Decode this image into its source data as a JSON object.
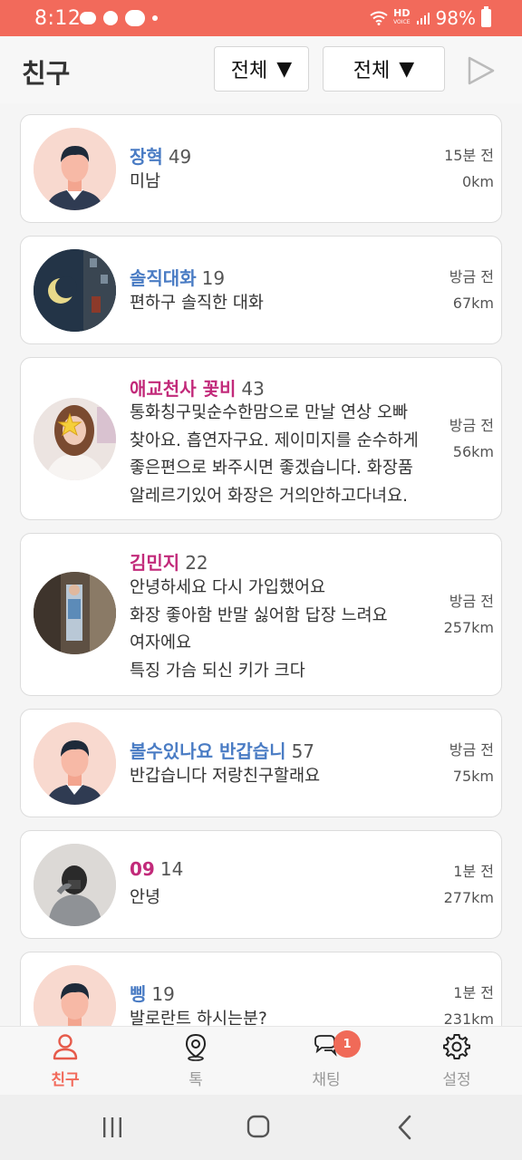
{
  "status_bar": {
    "time": "8:12",
    "battery": "98%",
    "hd_label": "HD",
    "voice_label": "VOICE"
  },
  "header": {
    "title": "친구",
    "filter1": {
      "label": "전체",
      "arrow": "▼"
    },
    "filter2": {
      "label": "전체",
      "arrow": "▼"
    }
  },
  "friends": [
    {
      "name": "장혁",
      "age": "49",
      "message": "미남",
      "time": "15분 전",
      "distance": "0km",
      "name_color": "blue"
    },
    {
      "name": "솔직대화",
      "age": "19",
      "message": "편하구 솔직한 대화",
      "time": "방금 전",
      "distance": "67km",
      "name_color": "blue"
    },
    {
      "name": "애교천사 꽃비",
      "age": "43",
      "message": "통화칭구및순수한맘으로 만날  연상 오빠\n찾아요.  흡연자구요. 제이미지를 순수하게\n좋은편으로 봐주시면 좋겠습니다. 화장품\n알레르기있어 화장은 거의안하고다녀요.",
      "time": "방금 전",
      "distance": "56km",
      "name_color": "pink"
    },
    {
      "name": "김민지",
      "age": "22",
      "message": "안녕하세요  다시 가입했어요\n화장 좋아함 반말 싫어함 답장 느려요\n여자에요\n특징 가슴  되신 키가 크다",
      "time": "방금 전",
      "distance": "257km",
      "name_color": "pink"
    },
    {
      "name": "볼수있나요 반갑습니",
      "age": "57",
      "message": "반갑습니다 저랑친구할래요",
      "time": "방금 전",
      "distance": "75km",
      "name_color": "blue"
    },
    {
      "name": "09",
      "age": "14",
      "message": "안녕",
      "time": "1분 전",
      "distance": "277km",
      "name_color": "pink"
    },
    {
      "name": "삥",
      "age": "19",
      "message": "발로란트 하시는분?",
      "time": "1분 전",
      "distance": "231km",
      "name_color": "blue"
    }
  ],
  "bottom_nav": {
    "items": [
      {
        "label": "친구",
        "icon": "person-icon",
        "active": true
      },
      {
        "label": "톡",
        "icon": "location-pin-icon",
        "active": false
      },
      {
        "label": "채팅",
        "icon": "chat-bubbles-icon",
        "active": false,
        "badge": "1"
      },
      {
        "label": "설정",
        "icon": "gear-icon",
        "active": false
      }
    ]
  },
  "colors": {
    "accent": "#f26a5b",
    "name_blue": "#4a7cc4",
    "name_pink": "#c22a7a"
  }
}
